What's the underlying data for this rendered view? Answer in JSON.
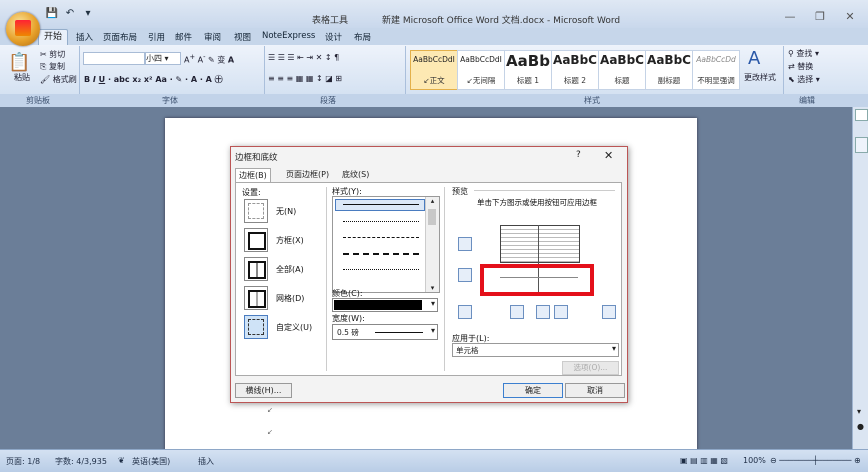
{
  "titlebar": {
    "context_group": "表格工具",
    "title": "新建 Microsoft Office Word 文档.docx - Microsoft Word",
    "qat": [
      "💾",
      "↶",
      "▾"
    ]
  },
  "tabs": [
    "开始",
    "插入",
    "页面布局",
    "引用",
    "邮件",
    "审阅",
    "视图",
    "NoteExpress",
    "设计",
    "布局"
  ],
  "ribbon": {
    "clipboard": {
      "paste": "粘贴",
      "cut": "剪切",
      "copy": "复制",
      "format_painter": "格式刷",
      "label": "剪贴板"
    },
    "font": {
      "size": "小四",
      "label": "字体"
    },
    "paragraph": {
      "label": "段落"
    },
    "styles": {
      "label": "样式",
      "items": [
        {
          "sample": "AaBbCcDdI",
          "name": "↙正文"
        },
        {
          "sample": "AaBbCcDdI",
          "name": "↙无间隔"
        },
        {
          "sample": "AaBb",
          "name": "标题 1"
        },
        {
          "sample": "AaBbC",
          "name": "标题 2"
        },
        {
          "sample": "AaBbC",
          "name": "标题"
        },
        {
          "sample": "AaBbC",
          "name": "副标题"
        },
        {
          "sample": "AaBbCcDd",
          "name": "不明显强调"
        }
      ],
      "change_styles": "更改样式"
    },
    "editing": {
      "find": "查找",
      "replace": "替换",
      "select": "选择",
      "label": "编辑"
    }
  },
  "dialog": {
    "title": "边框和底纹",
    "help": "?",
    "close": "✕",
    "tabs": [
      "边框(B)",
      "页面边框(P)",
      "底纹(S)"
    ],
    "setting_label": "设置:",
    "settings": [
      "无(N)",
      "方框(X)",
      "全部(A)",
      "网格(D)",
      "自定义(U)"
    ],
    "style_label": "样式(Y):",
    "color_label": "颜色(C):",
    "width_label": "宽度(W):",
    "width_value": "0.5 磅",
    "preview_label": "预览",
    "preview_hint": "单击下方图示或使用按钮可应用边框",
    "apply_to_label": "应用于(L):",
    "apply_to_value": "单元格",
    "options_button": "选项(O)...",
    "horizontal_line_button": "横线(H)...",
    "ok": "确定",
    "cancel": "取消"
  },
  "statusbar": {
    "page": "页面: 1/8",
    "words": "字数: 4/3,935",
    "language": "英语(美国)",
    "mode": "插入",
    "zoom": "100%"
  },
  "colors": {
    "highlight": "#e4101a",
    "ribbon": "#dfe8f4",
    "workspace": "#6b7e98"
  }
}
